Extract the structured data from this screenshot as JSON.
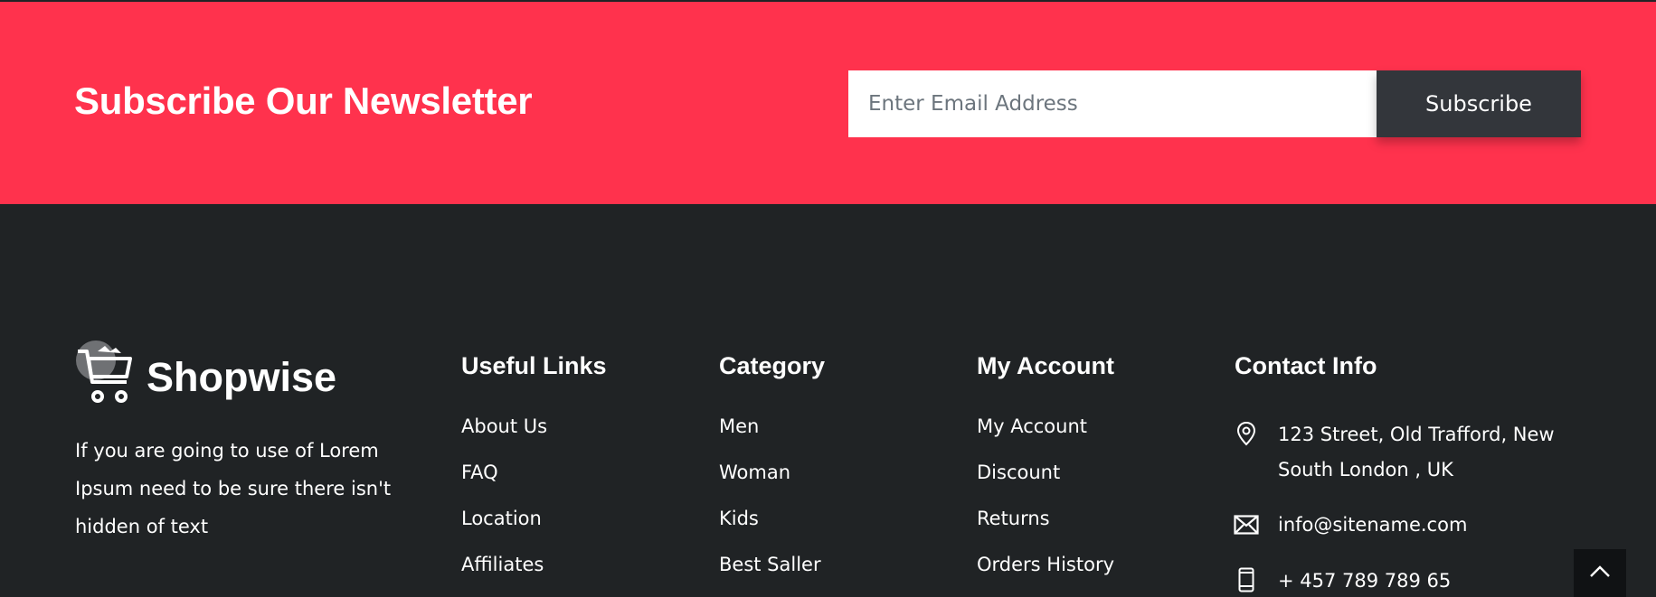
{
  "newsletter": {
    "title": "Subscribe Our Newsletter",
    "email_placeholder": "Enter Email Address",
    "subscribe_label": "Subscribe"
  },
  "footer": {
    "logo_text": "Shopwise",
    "about_text": "If you are going to use of Lorem Ipsum need to be sure there isn't hidden of text",
    "useful_links": {
      "title": "Useful Links",
      "items": [
        "About Us",
        "FAQ",
        "Location",
        "Affiliates"
      ]
    },
    "category": {
      "title": "Category",
      "items": [
        "Men",
        "Woman",
        "Kids",
        "Best Saller"
      ]
    },
    "my_account": {
      "title": "My Account",
      "items": [
        "My Account",
        "Discount",
        "Returns",
        "Orders History"
      ]
    },
    "contact": {
      "title": "Contact Info",
      "address": "123 Street, Old Trafford, New South London , UK",
      "email": "info@sitename.com",
      "phone": "+ 457 789 789 65"
    }
  },
  "icons": {
    "logo": "shopping-cart-icon",
    "address": "map-pin-icon",
    "email": "envelope-icon",
    "phone": "mobile-phone-icon",
    "scroll_top": "chevron-up-icon"
  },
  "colors": {
    "accent": "#ff324d",
    "footer_bg": "#202325",
    "button_bg": "#33363b"
  }
}
